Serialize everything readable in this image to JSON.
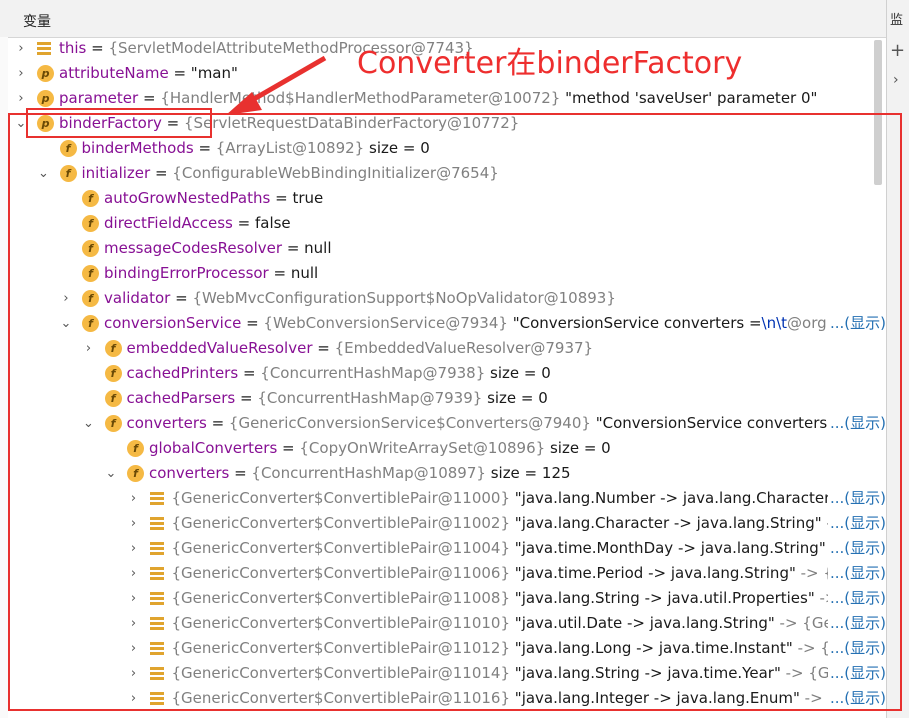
{
  "header": {
    "title": "变量",
    "right_label": "监",
    "plus": "+",
    "chevron": "›"
  },
  "annotation": {
    "text": "Converter在binderFactory",
    "color": "#e8312f"
  },
  "rows": [
    {
      "name": "this",
      "op": " = ",
      "ref": "{ServletModelAttributeMethodProcessor@7743}",
      "val": "",
      "icon": "list",
      "toggle": "›"
    },
    {
      "name": "attributeName",
      "op": " = ",
      "ref": "",
      "val": "\"man\"",
      "icon": "p",
      "toggle": "›"
    },
    {
      "name": "parameter",
      "op": " = ",
      "ref": "{HandlerMethod$HandlerMethodParameter@10072}",
      "val": " \"method 'saveUser' parameter 0\"",
      "icon": "p",
      "toggle": "›"
    },
    {
      "name": "binderFactory",
      "op": " = ",
      "ref": "{ServletRequestDataBinderFactory@10772}",
      "val": "",
      "icon": "p",
      "toggle": "⌄"
    },
    {
      "name": "binderMethods",
      "op": " = ",
      "ref": "{ArrayList@10892}",
      "val": "  size = 0",
      "icon": "f",
      "toggle": ""
    },
    {
      "name": "initializer",
      "op": " = ",
      "ref": "{ConfigurableWebBindingInitializer@7654}",
      "val": "",
      "icon": "f",
      "toggle": "⌄"
    },
    {
      "name": "autoGrowNestedPaths",
      "op": " = ",
      "ref": "",
      "val": "true",
      "icon": "f",
      "toggle": ""
    },
    {
      "name": "directFieldAccess",
      "op": " = ",
      "ref": "",
      "val": "false",
      "icon": "f",
      "toggle": ""
    },
    {
      "name": "messageCodesResolver",
      "op": " = ",
      "ref": "",
      "val": "null",
      "icon": "f",
      "toggle": ""
    },
    {
      "name": "bindingErrorProcessor",
      "op": " = ",
      "ref": "",
      "val": "null",
      "icon": "f",
      "toggle": ""
    },
    {
      "name": "validator",
      "op": " = ",
      "ref": "{WebMvcConfigurationSupport$NoOpValidator@10893}",
      "val": "",
      "icon": "f",
      "toggle": "›"
    },
    {
      "name": "conversionService",
      "op": " = ",
      "ref": "{WebConversionService@7934}",
      "val": " \"ConversionService converters =",
      "esc": "\\n\\t",
      "tail": "@org.sprir",
      "show": "...(显示)",
      "icon": "f",
      "toggle": "⌄"
    },
    {
      "name": "embeddedValueResolver",
      "op": " = ",
      "ref": "{EmbeddedValueResolver@7937}",
      "val": "",
      "icon": "f",
      "toggle": "›"
    },
    {
      "name": "cachedPrinters",
      "op": " = ",
      "ref": "{ConcurrentHashMap@7938}",
      "val": "  size = 0",
      "icon": "f",
      "toggle": ""
    },
    {
      "name": "cachedParsers",
      "op": " = ",
      "ref": "{ConcurrentHashMap@7939}",
      "val": "  size = 0",
      "icon": "f",
      "toggle": ""
    },
    {
      "name": "converters",
      "op": " = ",
      "ref": "{GenericConversionService$Converters@7940}",
      "val": " \"ConversionService converters =",
      "esc": "\\n\\t",
      "tail": "",
      "show": "...(显示)",
      "icon": "f",
      "toggle": "⌄"
    },
    {
      "name": "globalConverters",
      "op": " = ",
      "ref": "{CopyOnWriteArraySet@10896}",
      "val": "  size = 0",
      "icon": "f",
      "toggle": ""
    },
    {
      "name": "converters",
      "op": " = ",
      "ref": "{ConcurrentHashMap@10897}",
      "val": "  size = 125",
      "icon": "f",
      "toggle": "⌄"
    },
    {
      "name": "",
      "op": "",
      "ref": "{GenericConverter$ConvertiblePair@11000}",
      "val": " \"java.lang.Number -> java.lang.Character\"",
      "tail": " -> {C",
      "show": "...(显示)",
      "icon": "list",
      "toggle": "›"
    },
    {
      "name": "",
      "op": "",
      "ref": "{GenericConverter$ConvertiblePair@11002}",
      "val": " \"java.lang.Character -> java.lang.String\"",
      "tail": " -> {Ge",
      "show": "...(显示)",
      "icon": "list",
      "toggle": "›"
    },
    {
      "name": "",
      "op": "",
      "ref": "{GenericConverter$ConvertiblePair@11004}",
      "val": " \"java.time.MonthDay -> java.lang.String\"",
      "tail": " -> {G",
      "show": "...(显示)",
      "icon": "list",
      "toggle": "›"
    },
    {
      "name": "",
      "op": "",
      "ref": "{GenericConverter$ConvertiblePair@11006}",
      "val": " \"java.time.Period -> java.lang.String\"",
      "tail": " -> {Gener",
      "show": "...(显示)",
      "icon": "list",
      "toggle": "›"
    },
    {
      "name": "",
      "op": "",
      "ref": "{GenericConverter$ConvertiblePair@11008}",
      "val": " \"java.lang.String -> java.util.Properties\"",
      "tail": " -> {Ge",
      "show": "...(显示)",
      "icon": "list",
      "toggle": "›"
    },
    {
      "name": "",
      "op": "",
      "ref": "{GenericConverter$ConvertiblePair@11010}",
      "val": " \"java.util.Date -> java.lang.String\"",
      "tail": " -> {GenericC",
      "show": "...(显示)",
      "icon": "list",
      "toggle": "›"
    },
    {
      "name": "",
      "op": "",
      "ref": "{GenericConverter$ConvertiblePair@11012}",
      "val": " \"java.lang.Long -> java.time.Instant\"",
      "tail": " -> {Generi",
      "show": "...(显示)",
      "icon": "list",
      "toggle": "›"
    },
    {
      "name": "",
      "op": "",
      "ref": "{GenericConverter$ConvertiblePair@11014}",
      "val": " \"java.lang.String -> java.time.Year\"",
      "tail": " -> {Generic",
      "show": "...(显示)",
      "icon": "list",
      "toggle": "›"
    },
    {
      "name": "",
      "op": "",
      "ref": "{GenericConverter$ConvertiblePair@11016}",
      "val": " \"java.lang.Integer -> java.lang.Enum\"",
      "tail": " -> {Gener",
      "show": "...(显示)",
      "icon": "list",
      "toggle": "›"
    }
  ]
}
